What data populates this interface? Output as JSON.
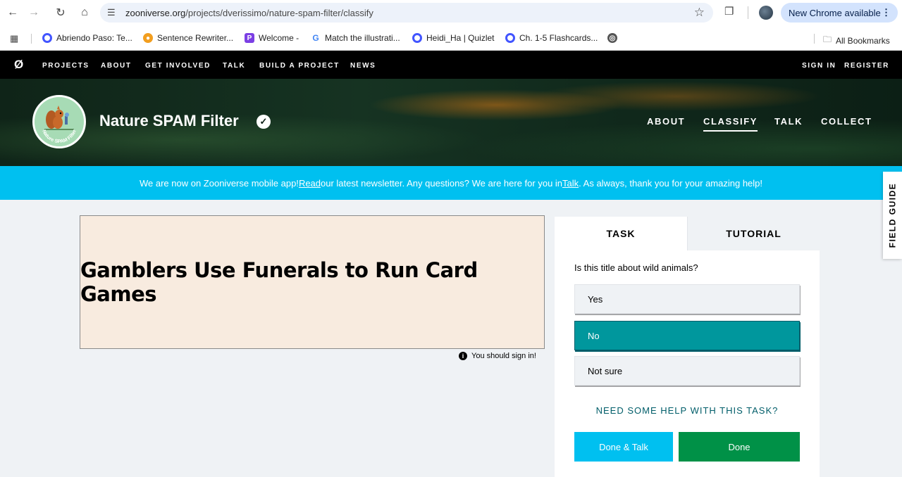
{
  "browser": {
    "url_host": "zooniverse.org",
    "url_path": "/projects/dverissimo/nature-spam-filter/classify",
    "update_label": "New Chrome available",
    "bookmarks": [
      {
        "label": "Abriendo Paso: Te...",
        "icon": "quizlet-icon"
      },
      {
        "label": "Sentence Rewriter...",
        "icon": "rewriter-icon"
      },
      {
        "label": "Welcome -",
        "icon": "welcome-icon"
      },
      {
        "label": "Match the illustrati...",
        "icon": "google-icon"
      },
      {
        "label": "Heidi_Ha | Quizlet",
        "icon": "quizlet-icon"
      },
      {
        "label": "Ch. 1-5 Flashcards...",
        "icon": "quizlet-icon"
      }
    ],
    "all_bookmarks_label": "All Bookmarks"
  },
  "zoo_nav": {
    "links": [
      "PROJECTS",
      "ABOUT",
      "GET INVOLVED",
      "TALK",
      "BUILD A PROJECT",
      "NEWS"
    ],
    "sign_in": "SIGN IN",
    "register": "REGISTER"
  },
  "project": {
    "title": "Nature SPAM Filter",
    "avatar_text": "Nature SPAM Filter",
    "nav": [
      "ABOUT",
      "CLASSIFY",
      "TALK",
      "COLLECT"
    ],
    "active_nav": "CLASSIFY"
  },
  "announcement": {
    "part1": "We are now on Zooniverse mobile app! ",
    "link1": "Read",
    "part2": " our latest newsletter. Any questions? We are here for you in ",
    "link2": "Talk",
    "part3": ". As always, thank you for your amazing help!"
  },
  "field_guide_label": "FIELD GUIDE",
  "subject": {
    "text": "Gamblers Use Funerals to Run Card Games",
    "note": "You should sign in!"
  },
  "task_panel": {
    "tabs": [
      "TASK",
      "TUTORIAL"
    ],
    "question": "Is this title about wild animals?",
    "answers": [
      "Yes",
      "No",
      "Not sure"
    ],
    "selected_answer": "No",
    "help_link": "NEED SOME HELP WITH THIS TASK?",
    "done_talk_label": "Done & Talk",
    "done_label": "Done"
  },
  "colors": {
    "announce_bg": "#00c0f0",
    "selected_answer": "#00979d",
    "done_button": "#009147",
    "done_talk_button": "#00c0f0"
  }
}
